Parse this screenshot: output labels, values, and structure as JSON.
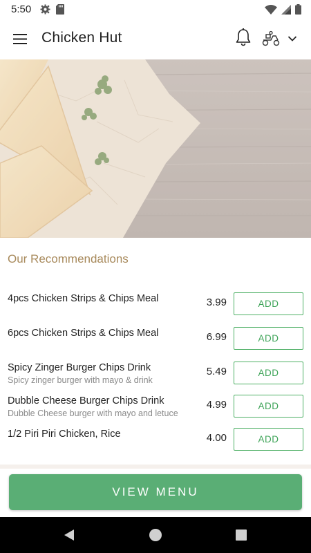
{
  "status_bar": {
    "time": "5:50",
    "left_icons": [
      "gear-icon",
      "sd-card-icon"
    ],
    "right_icons": [
      "wifi-icon",
      "signal-icon",
      "battery-icon"
    ]
  },
  "app_bar": {
    "title": "Chicken Hut",
    "icons": [
      "hamburger-menu-icon",
      "bell-icon",
      "delivery-scooter-icon",
      "chevron-down-icon"
    ]
  },
  "hero": {
    "image": "samosas on parchment paper over wooden table"
  },
  "recommendations": {
    "title": "Our Recommendations",
    "add_label": "ADD",
    "items": [
      {
        "name": "4pcs Chicken Strips & Chips Meal",
        "description": "",
        "price": "3.99"
      },
      {
        "name": "6pcs Chicken Strips & Chips Meal",
        "description": "",
        "price": "6.99"
      },
      {
        "name": "Spicy Zinger Burger Chips Drink",
        "description": "Spicy zinger burger with mayo & drink",
        "price": "5.49"
      },
      {
        "name": "Dubble Cheese Burger Chips Drink",
        "description": "Dubble Cheese burger with mayo and letuce",
        "price": "4.99"
      },
      {
        "name": "1/2 Piri Piri Chicken, Rice",
        "description": "",
        "price": "4.00"
      }
    ]
  },
  "footer": {
    "view_menu_label": "VIEW MENU"
  },
  "nav_bar": {
    "icons": [
      "back-icon",
      "home-icon",
      "recents-icon"
    ]
  },
  "colors": {
    "accent_green": "#5aae75",
    "add_green": "#3da357",
    "section_title": "#a88a5c"
  }
}
